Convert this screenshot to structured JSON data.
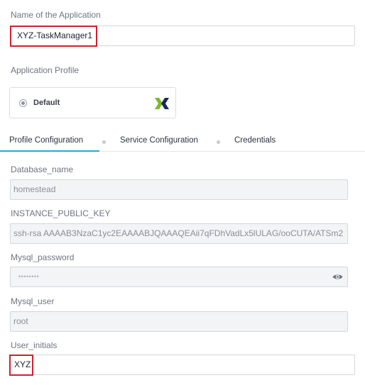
{
  "app_name": {
    "label": "Name of the Application",
    "value": "XYZ-TaskManager1"
  },
  "profile": {
    "label": "Application Profile",
    "selected": "Default",
    "icon": "nutanix-logo-icon"
  },
  "tabs": [
    {
      "label": "Profile Configuration",
      "active": true
    },
    {
      "label": "Service Configuration",
      "active": false
    },
    {
      "label": "Credentials",
      "active": false
    }
  ],
  "fields": {
    "database_name": {
      "label": "Database_name",
      "value": "homestead"
    },
    "instance_public_key": {
      "label": "INSTANCE_PUBLIC_KEY",
      "value": "ssh-rsa AAAAB3NzaC1yc2EAAAABJQAAAQEAii7qFDhVadLx5lULAG/ooCUTA/ATSm2"
    },
    "mysql_password": {
      "label": "Mysql_password",
      "value": "••••••••",
      "icon": "eye-icon"
    },
    "mysql_user": {
      "label": "Mysql_user",
      "value": "root"
    },
    "user_initials": {
      "label": "User_initials",
      "value": "XYZ"
    }
  },
  "colors": {
    "highlight": "#d2202f",
    "tab_active": "#2aa6d9"
  }
}
